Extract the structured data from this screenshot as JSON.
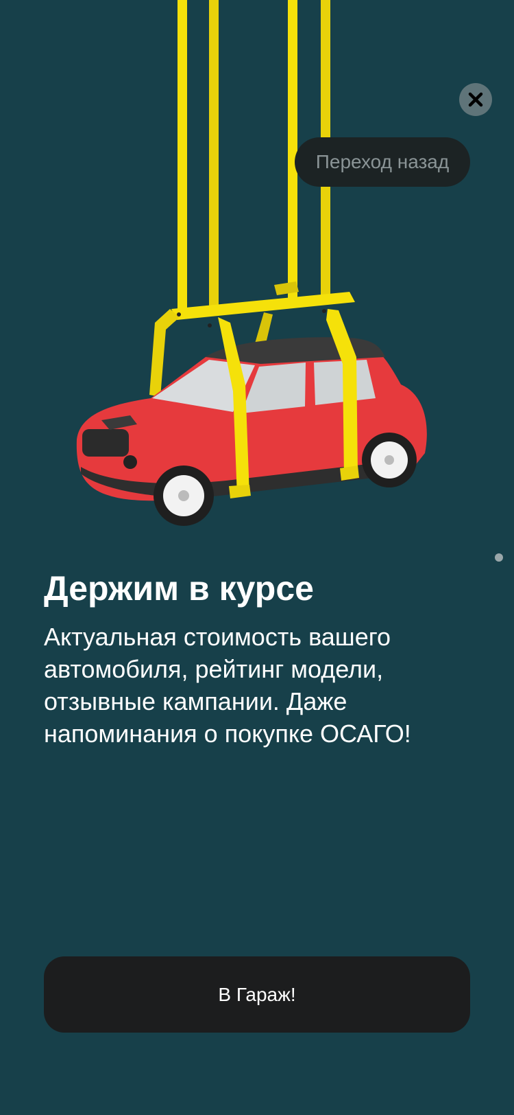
{
  "overlay": {
    "close_icon": "close-icon",
    "back_label": "Переход назад"
  },
  "illustration": {
    "subject": "car-on-lift",
    "colors": {
      "background": "#17404a",
      "car": "#e63a3d",
      "frame": "#f5e10a"
    }
  },
  "onboarding": {
    "title": "Держим в курсе",
    "description_lines": [
      "Актуальная стоимость вашего",
      "автомобиля, рейтинг модели,",
      "отзывные кампании. Даже",
      "напоминания о покупке ОСАГО!"
    ]
  },
  "cta": {
    "label": "В Гараж!"
  }
}
